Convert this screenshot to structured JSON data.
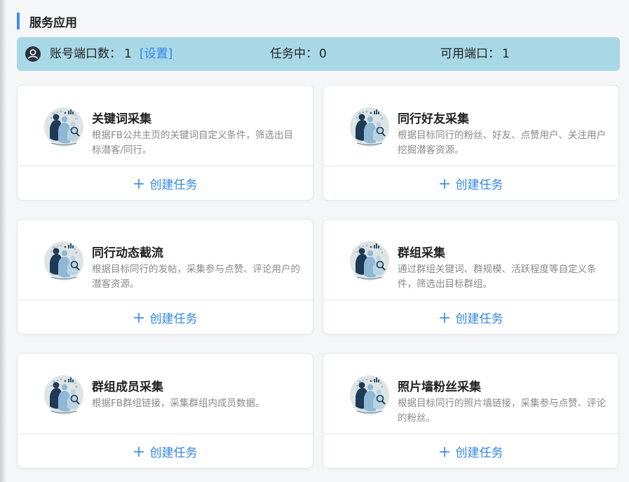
{
  "section": {
    "title": "服务应用"
  },
  "status": {
    "account_ports_label": "账号端口数：",
    "account_ports_value": "1",
    "settings_link": "[设置]",
    "tasks_label": "任务中：",
    "tasks_value": "0",
    "available_label": "可用端口：",
    "available_value": "1"
  },
  "accent_color": "#2f86e8",
  "cards": [
    {
      "icon": "people-analytics-icon",
      "title": "关键词采集",
      "desc": "根据FB公共主页的关键词自定义条件，筛选出目标潜客/同行。",
      "action": "创建任务"
    },
    {
      "icon": "people-analytics-icon",
      "title": "同行好友采集",
      "desc": "根据目标同行的粉丝、好友、点赞用户、关注用户挖掘潜客资源。",
      "action": "创建任务"
    },
    {
      "icon": "people-analytics-icon",
      "title": "同行动态截流",
      "desc": "根据目标同行的发帖，采集参与点赞、评论用户的潜客资源。",
      "action": "创建任务"
    },
    {
      "icon": "people-analytics-icon",
      "title": "群组采集",
      "desc": "通过群组关键词、群规模、活跃程度等自定义条件，筛选出目标群组。",
      "action": "创建任务"
    },
    {
      "icon": "people-analytics-icon",
      "title": "群组成员采集",
      "desc": "根据FB群组链接，采集群组内成员数据。",
      "action": "创建任务"
    },
    {
      "icon": "people-analytics-icon",
      "title": "照片墙粉丝采集",
      "desc": "根据目标同行的照片墙链接，采集参与点赞、评论的粉丝。",
      "action": "创建任务"
    }
  ]
}
